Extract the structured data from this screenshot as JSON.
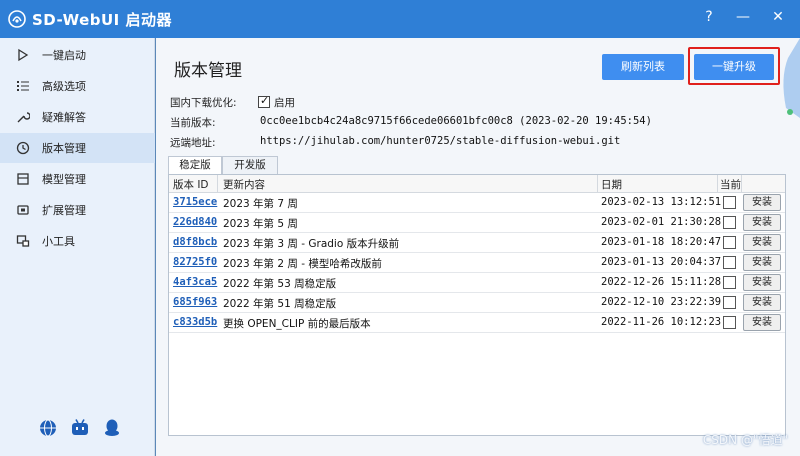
{
  "window": {
    "title": "SD-WebUI 启动器",
    "help": "?",
    "minimize": "—",
    "close": "✕"
  },
  "sidebar": {
    "items": [
      {
        "label": "一键启动",
        "icon": "play-icon"
      },
      {
        "label": "高级选项",
        "icon": "list-icon"
      },
      {
        "label": "疑难解答",
        "icon": "wrench-icon"
      },
      {
        "label": "版本管理",
        "icon": "history-icon",
        "active": true
      },
      {
        "label": "模型管理",
        "icon": "cube-icon"
      },
      {
        "label": "扩展管理",
        "icon": "puzzle-icon"
      },
      {
        "label": "小工具",
        "icon": "toolbox-icon"
      }
    ],
    "bottom_icons": [
      "globe-icon",
      "bilibili-icon",
      "qq-icon"
    ]
  },
  "page": {
    "title": "版本管理",
    "refresh_button": "刷新列表",
    "upgrade_button": "一键升级",
    "mirror_label": "国内下载优化:",
    "mirror_checkbox_label": "启用",
    "mirror_enabled": true,
    "current_version_label": "当前版本:",
    "current_version_value": "0cc0ee1bcb4c24a8c9715f66cede06601bfc00c8 (2023-02-20 19:45:54)",
    "remote_label": "远端地址:",
    "remote_value": "https://jihulab.com/hunter0725/stable-diffusion-webui.git"
  },
  "tabs": [
    {
      "label": "稳定版",
      "active": true
    },
    {
      "label": "开发版",
      "active": false
    }
  ],
  "table": {
    "headers": {
      "id": "版本 ID",
      "desc": "更新内容",
      "date": "日期",
      "current": "当前"
    },
    "install_label": "安装",
    "rows": [
      {
        "id": "3715ece",
        "desc": "2023 年第 7 周",
        "date": "2023-02-13 13:12:51"
      },
      {
        "id": "226d840",
        "desc": "2023 年第 5 周",
        "date": "2023-02-01 21:30:28"
      },
      {
        "id": "d8f8bcb",
        "desc": "2023 年第 3 周 - Gradio 版本升级前",
        "date": "2023-01-18 18:20:47"
      },
      {
        "id": "82725f0",
        "desc": "2023 年第 2 周 - 模型哈希改版前",
        "date": "2023-01-13 20:04:37"
      },
      {
        "id": "4af3ca5",
        "desc": "2022 年第 53 周稳定版",
        "date": "2022-12-26 15:11:28"
      },
      {
        "id": "685f963",
        "desc": "2022 年第 51 周稳定版",
        "date": "2022-12-10 23:22:39"
      },
      {
        "id": "c833d5b",
        "desc": "更换 OPEN_CLIP 前的最后版本",
        "date": "2022-11-26 10:12:23"
      }
    ]
  },
  "watermark": "CSDN @\"悟道\"",
  "colors": {
    "titlebar": "#2f7fd6",
    "accent": "#3f8ef0",
    "highlight": "#e0201c"
  }
}
